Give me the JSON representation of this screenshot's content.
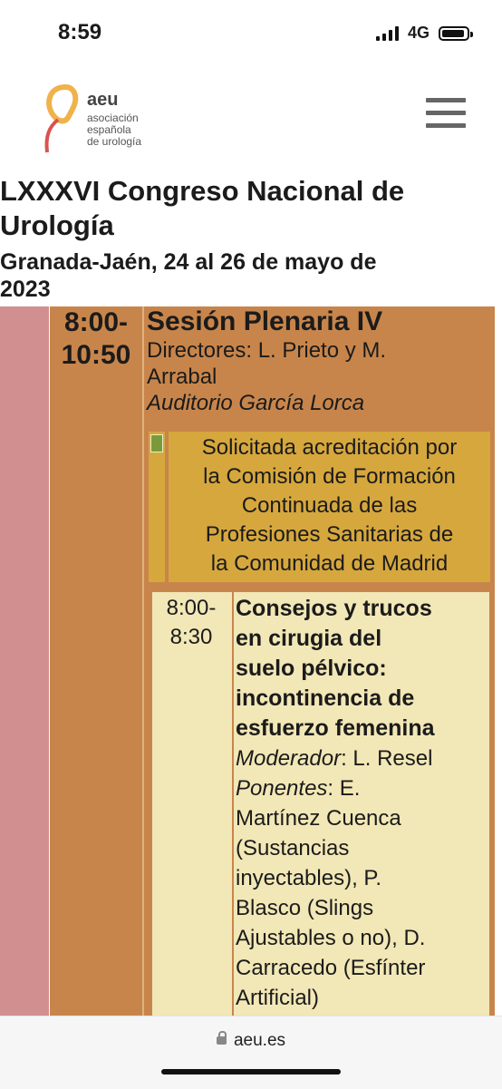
{
  "status": {
    "time": "8:59",
    "network": "4G"
  },
  "logo": {
    "brand": "aeu",
    "line1": "asociación",
    "line2": "española",
    "line3": "de urología"
  },
  "header": {
    "title_line1": "LXXXVI Congreso Nacional de",
    "title_line2": "Urología",
    "subtitle_line1": "Granada-Jaén, 24 al 26 de mayo de",
    "subtitle_line2": "2023"
  },
  "session": {
    "time_start": "8:00-",
    "time_end": "10:50",
    "title": "Sesión Plenaria IV",
    "directors_line1": "Directores: L. Prieto y M.",
    "directors_line2": "Arrabal",
    "location": "Auditorio García Lorca",
    "accreditation_lines": [
      "Solicitada acreditación por",
      "la Comisión de Formación",
      "Continuada de las",
      "Profesiones Sanitarias de",
      "la Comunidad de Madrid"
    ]
  },
  "talk": {
    "time_start": "8:00-",
    "time_end": "8:30",
    "title_lines": [
      "Consejos y trucos",
      "en cirugia del",
      "suelo pélvico:",
      "incontinencia de",
      "esfuerzo femenina"
    ],
    "moderator_label": "Moderador",
    "moderator_value": ": L. Resel",
    "speakers_label": "Ponentes",
    "speakers_value": ": E.",
    "speaker_lines": [
      "Martínez Cuenca",
      "(Sustancias",
      "inyectables), P.",
      "Blasco (Slings",
      "Ajustables o no), D.",
      "Carracedo (Esfínter",
      "Artificial)"
    ]
  },
  "browser": {
    "url": "aeu.es"
  },
  "colors": {
    "pink_column": "#d28f8f",
    "session_bg": "#c8854b",
    "accreditation_bg": "#d6a73d",
    "talk_bg": "#f2e7b6"
  }
}
